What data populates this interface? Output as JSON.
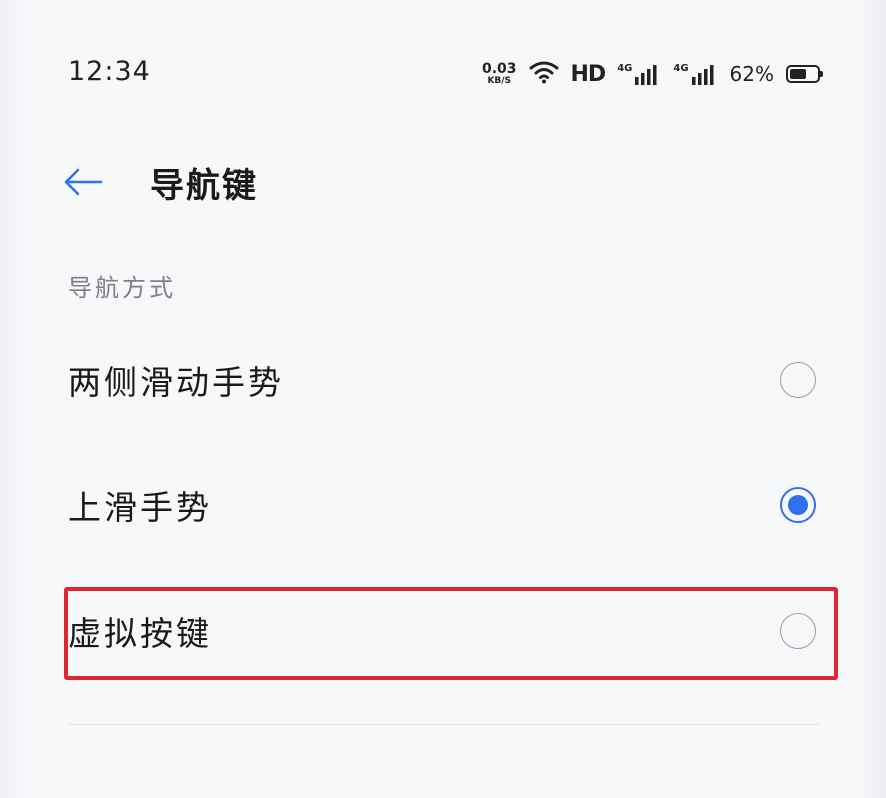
{
  "status_bar": {
    "time": "12:34",
    "net_speed_value": "0.03",
    "net_speed_unit": "KB/S",
    "wifi_icon": "wifi-icon",
    "hd_label": "HD",
    "signal_1_generation": "4G",
    "signal_2_generation": "4G",
    "battery_percent": "62%",
    "battery_level": 0.62
  },
  "header": {
    "back_icon": "arrow-left-icon",
    "title": "导航键"
  },
  "section": {
    "label": "导航方式",
    "options": [
      {
        "label": "两侧滑动手势",
        "selected": false
      },
      {
        "label": "上滑手势",
        "selected": true
      },
      {
        "label": "虚拟按键",
        "selected": false,
        "highlighted": true
      }
    ]
  },
  "colors": {
    "accent": "#2f6ff0",
    "highlight": "#e0262e",
    "background": "#f7f8fa"
  }
}
